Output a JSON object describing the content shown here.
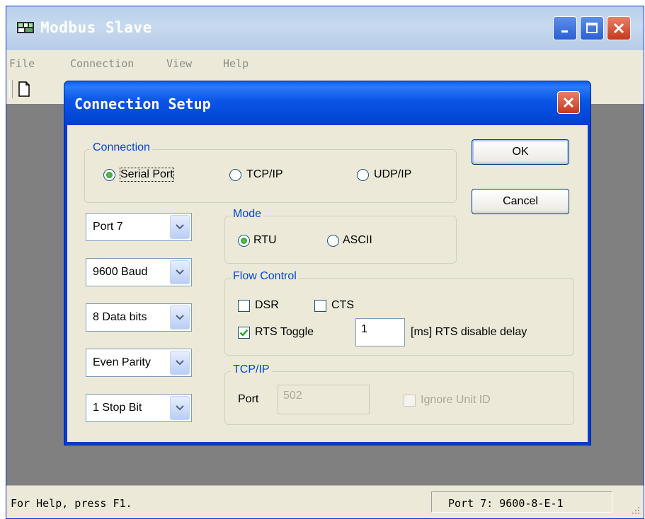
{
  "window": {
    "title": "Modbus Slave"
  },
  "menu": [
    "File",
    "Connection",
    "View",
    "Help"
  ],
  "status": {
    "left": "For Help, press F1.",
    "right": "Port 7: 9600-8-E-1"
  },
  "dialog": {
    "title": "Connection Setup",
    "connection": {
      "title": "Connection",
      "options": [
        "Serial Port",
        "TCP/IP",
        "UDP/IP"
      ],
      "selected": "Serial Port"
    },
    "serial": {
      "port": "Port 7",
      "baud": "9600 Baud",
      "data_bits": "8 Data bits",
      "parity": "Even Parity",
      "stop_bits": "1 Stop Bit"
    },
    "mode": {
      "title": "Mode",
      "options": [
        "RTU",
        "ASCII"
      ],
      "selected": "RTU"
    },
    "flow": {
      "title": "Flow Control",
      "dsr": {
        "label": "DSR",
        "checked": false
      },
      "cts": {
        "label": "CTS",
        "checked": false
      },
      "rts_toggle": {
        "label": "RTS Toggle",
        "checked": true
      },
      "rts_delay_value": "1",
      "rts_delay_label": "[ms] RTS disable delay"
    },
    "tcpip": {
      "title": "TCP/IP",
      "port_label": "Port",
      "port_value": "502",
      "ignore_unit_id": {
        "label": "Ignore Unit ID",
        "checked": false
      }
    },
    "buttons": {
      "ok": "OK",
      "cancel": "Cancel"
    }
  }
}
